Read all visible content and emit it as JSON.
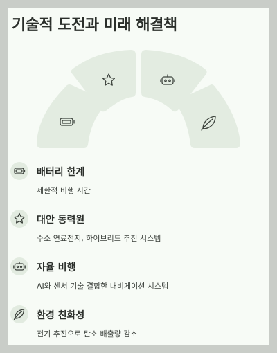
{
  "title": "기술적 도전과 미래 해결책",
  "colors": {
    "segment_fill": "#e3ece1",
    "icon_circle": "#e2ebe0",
    "card_background": "#f7fbf6",
    "outer_background": "#c9cdc8",
    "text": "#2b2f2b"
  },
  "fan_segments": [
    {
      "icon": "battery-icon"
    },
    {
      "icon": "star-icon"
    },
    {
      "icon": "robot-icon"
    },
    {
      "icon": "leaf-icon"
    }
  ],
  "items": [
    {
      "icon": "battery-icon",
      "title": "배터리 한계",
      "description": "제한적 비행 시간"
    },
    {
      "icon": "star-icon",
      "title": "대안 동력원",
      "description": "수소 연료전지, 하이브리드 추진 시스템"
    },
    {
      "icon": "robot-icon",
      "title": "자율 비행",
      "description": "AI와 센서 기술 결합한 내비게이션 시스템"
    },
    {
      "icon": "leaf-icon",
      "title": "환경 친화성",
      "description": "전기 추진으로 탄소 배출량 감소"
    }
  ]
}
